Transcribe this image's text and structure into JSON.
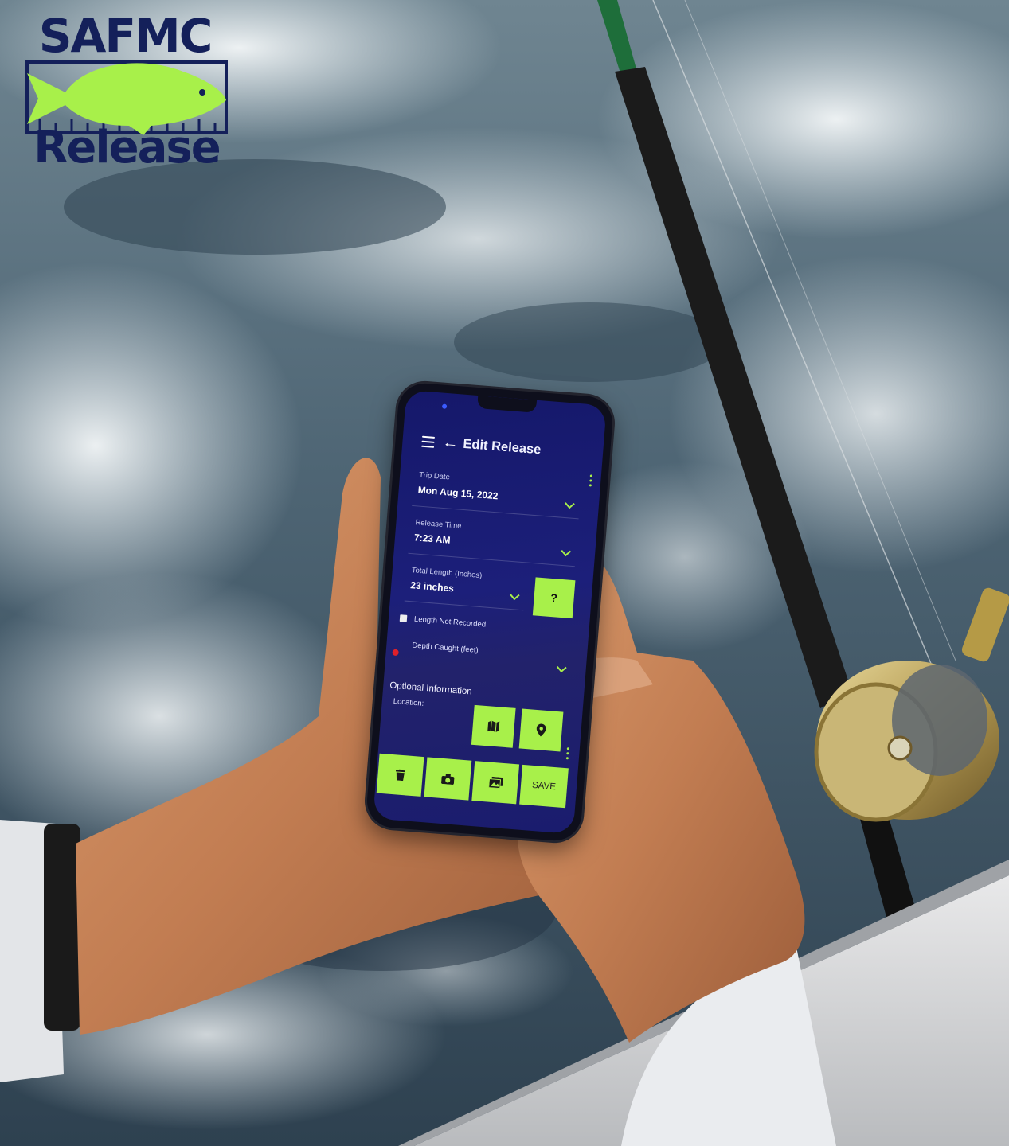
{
  "logo": {
    "top_text": "SAFMC",
    "bottom_text": "Release",
    "fish_color": "#a8f04a",
    "text_color": "#14205a"
  },
  "app": {
    "title": "Edit Release",
    "icons": {
      "menu": "menu-icon",
      "back": "arrow-left-icon"
    },
    "fields": {
      "trip_date": {
        "label": "Trip Date",
        "value": "Mon Aug 15, 2022"
      },
      "release_time": {
        "label": "Release Time",
        "value": "7:23 AM"
      },
      "total_length": {
        "label": "Total Length (Inches)",
        "value": "23 inches"
      }
    },
    "help_button": "?",
    "length_not_recorded": "Length Not Recorded",
    "depth_label": "Depth Caught (feet)",
    "optional_title": "Optional Information",
    "location_label": "Location:",
    "bottom_actions": {
      "delete_icon": "trash-icon",
      "camera_icon": "camera-icon",
      "gallery_icon": "gallery-icon",
      "save_label": "SAVE"
    },
    "accent_color": "#a8f04a",
    "background_color": "#1c1f7a"
  }
}
